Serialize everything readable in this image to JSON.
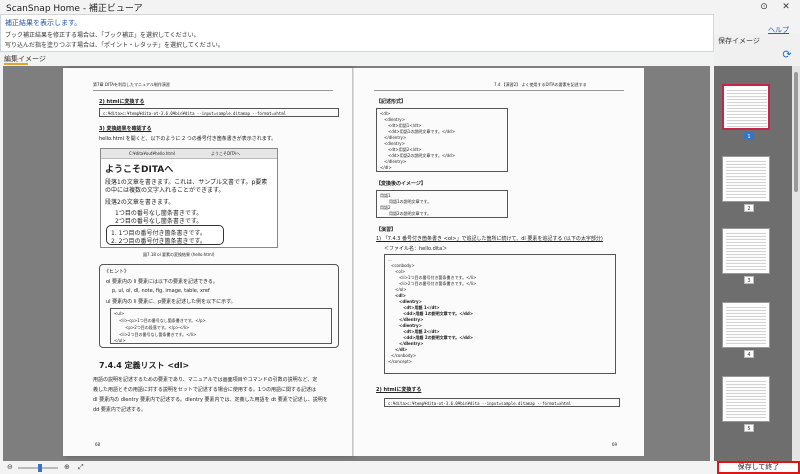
{
  "window": {
    "title": "ScanSnap Home - 補正ビューア",
    "pin_icon": "pin-icon",
    "close_icon": "close-icon"
  },
  "info": {
    "message1": "補正結果を表示します。",
    "message2": "ブック補正結果を修正する場合は、「ブック補正」を選択してください。",
    "message3": "写り込んだ指を塗りつぶす場合は、「ポイント・レタッチ」を選択してください。",
    "help": "ヘルプ"
  },
  "edit_image_label": "編集イメージ",
  "saved_images_label": "保存イメージ",
  "save_exit_label": "保存して終了",
  "left_page": {
    "header": "第7章 DITAを利用したマニュアル制作演習",
    "step2": "2) htmlに変換する",
    "cmd1": "c:¥dita>c:¥temp¥dita-ot-3.6.0¥bin¥dita --input=sample.ditamap --format=xhtml",
    "step3": "3) 変換結果を確認する",
    "intro": "hello.html を開くと、以下のように 2 つの番号付き箇条書きが表示されます。",
    "browser_url": "C:¥dita¥out¥hello.html",
    "browser_tab": "ようこそDITAへ",
    "browser_heading": "ようこそDITAへ",
    "para1a": "段落1の文章を書きます。これは、サンプル文書です。p要素",
    "para1b": "の中には複数の文字入れることができます。",
    "para2": "段落2の文章を書きます。",
    "bullet1": "1つ目の番号なし箇条書きです。",
    "bullet2": "2つ目の番号なし箇条書きです。",
    "num1": "1. 1つ目の番号付き箇条書きです。",
    "num2": "2. 2つ目の番号付き箇条書きです。",
    "fig_caption": "図7.18 ol 要素の変換結果 (hello.html)",
    "hint_title": "《ヒント》",
    "hint1": "ol 要素内の li 要素には以下の要素を記述できる。",
    "hint2": "p, ul, ol, dl, note, fig, image, table, xref",
    "hint3": "ul 要素内の li 要素に、p要素を記述した例を以下に示す。",
    "code1": "<ul>",
    "code2": "<li><p>1つ目の番号なし箇条書きです。</p>",
    "code3": "<p>2つ目の段落です。</p></li>",
    "code4": "<li>2つ目の番号なし箇条書きです。</li>",
    "code5": "</ul>",
    "section_title": "7.4.4 定義リスト <dl>",
    "body1": "用語の説明を記述するための要素であり、マニュアルでは画面項目やコマンドの引数の説明など、定",
    "body2": "義した用語とその用語に対する説明をセットで記述する場合に使用する。1つの用語に関する記述は",
    "body3": "dl 要素内の dlentry 要素内で記述する。dlentry 要素内では、定義した用語を dt 要素で記述し、説明を",
    "body4": "dd 要素内で記述する。",
    "page_num": "68"
  },
  "right_page": {
    "header": "7.4 【演習2】 よく使用するDITAの要素を記述する",
    "syntax_label": "【記述形式】",
    "syn1": "<dl>",
    "syn2": "<dlentry>",
    "syn3": "<dt>用語1</dt>",
    "syn4": "<dd>用語1の説明文章です。</dd>",
    "syn5": "</dlentry>",
    "syn6": "<dlentry>",
    "syn7": "<dt>用語2</dt>",
    "syn8": "<dd>用語2の説明文章です。</dd>",
    "syn9": "</dlentry>",
    "syn10": "</dl>",
    "after_label": "【変換後のイメージ】",
    "aft1": "用語1",
    "aft2": "用語1の説明文章です。",
    "aft3": "用語2",
    "aft4": "用語2の説明文章です。",
    "practice_label": "【演習】",
    "prac1": "1) 「7.4.3 番号付き箇条書き <ol>」で追記した箇所に続けて、dl 要素を追記する (以下の太字部分)",
    "file_label": "＜ファイル名：hello.dita＞",
    "c1": "...",
    "c2": "<conbody>",
    "c3": "<ol>",
    "c4": "<li>1つ目の番号付き箇条書きです。</li>",
    "c5": "<li>2つ目の番号付き箇条書きです。</li>",
    "c6": "</ol>",
    "c7": "<dl>",
    "c8": "<dlentry>",
    "c9": "<dt>用語 1</dt>",
    "c10": "<dd>用語 1の説明文章です。</dd>",
    "c11": "</dlentry>",
    "c12": "<dlentry>",
    "c13": "<dt>用語 2</dt>",
    "c14": "<dd>用語 2の説明文章です。</dd>",
    "c15": "</dlentry>",
    "c16": "</dl>",
    "c17": "</conbody>",
    "c18": "</concept>",
    "step2": "2) htmlに変換する",
    "cmd2": "c:¥dita>c:¥temp¥dita-ot-3.6.0¥bin¥dita --input=sample.ditamap --format=xhtml",
    "page_num": "69"
  },
  "thumbnails": [
    {
      "num": "1",
      "selected": true
    },
    {
      "num": "2",
      "selected": false
    },
    {
      "num": "3",
      "selected": false
    },
    {
      "num": "4",
      "selected": false
    },
    {
      "num": "5",
      "selected": false
    }
  ],
  "icons": {
    "zoom_out": "zoom-out-icon",
    "zoom_in": "zoom-in-icon",
    "fit": "fit-page-icon",
    "panel": "rotate-icon"
  }
}
